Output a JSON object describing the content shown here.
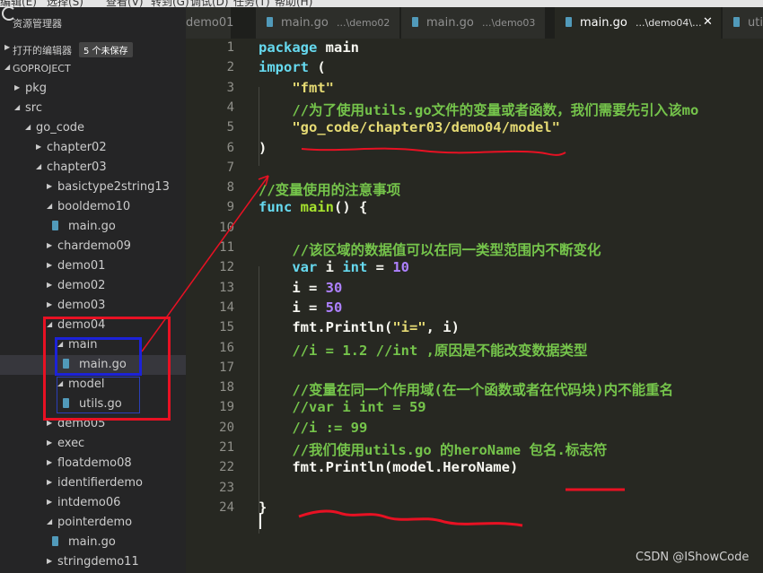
{
  "menubar": [
    "编辑(E)",
    "选择(S)",
    "查看(V)",
    "转到(G)",
    "调试(D)",
    "任务(T)",
    "帮助(H)"
  ],
  "explorer": {
    "title": "资源管理器",
    "open_editors_label": "打开的编辑器",
    "unsaved_badge": "5 个未保存",
    "project_label": "GOPROJECT",
    "tree": [
      {
        "name": "pkg",
        "kind": "folder",
        "depth": 0,
        "expanded": false
      },
      {
        "name": "src",
        "kind": "folder",
        "depth": 0,
        "expanded": true
      },
      {
        "name": "go_code",
        "kind": "folder",
        "depth": 1,
        "expanded": true
      },
      {
        "name": "chapter02",
        "kind": "folder",
        "depth": 2,
        "expanded": false
      },
      {
        "name": "chapter03",
        "kind": "folder",
        "depth": 2,
        "expanded": true
      },
      {
        "name": "basictype2string13",
        "kind": "folder",
        "depth": 3,
        "expanded": false
      },
      {
        "name": "booldemo10",
        "kind": "folder",
        "depth": 3,
        "expanded": true
      },
      {
        "name": "main.go",
        "kind": "file",
        "depth": 4
      },
      {
        "name": "chardemo09",
        "kind": "folder",
        "depth": 3,
        "expanded": false
      },
      {
        "name": "demo01",
        "kind": "folder",
        "depth": 3,
        "expanded": false
      },
      {
        "name": "demo02",
        "kind": "folder",
        "depth": 3,
        "expanded": false
      },
      {
        "name": "demo03",
        "kind": "folder",
        "depth": 3,
        "expanded": false
      },
      {
        "name": "demo04",
        "kind": "folder",
        "depth": 3,
        "expanded": true
      },
      {
        "name": "main",
        "kind": "folder",
        "depth": 4,
        "expanded": true
      },
      {
        "name": "main.go",
        "kind": "file",
        "depth": 5,
        "selected": true
      },
      {
        "name": "model",
        "kind": "folder",
        "depth": 4,
        "expanded": true
      },
      {
        "name": "utils.go",
        "kind": "file",
        "depth": 5
      },
      {
        "name": "demo05",
        "kind": "folder",
        "depth": 3,
        "expanded": false
      },
      {
        "name": "exec",
        "kind": "folder",
        "depth": 3,
        "expanded": false
      },
      {
        "name": "floatdemo08",
        "kind": "folder",
        "depth": 3,
        "expanded": false
      },
      {
        "name": "identifierdemo",
        "kind": "folder",
        "depth": 3,
        "expanded": false
      },
      {
        "name": "intdemo06",
        "kind": "folder",
        "depth": 3,
        "expanded": false
      },
      {
        "name": "pointerdemo",
        "kind": "folder",
        "depth": 3,
        "expanded": true
      },
      {
        "name": "main.go",
        "kind": "file",
        "depth": 4
      },
      {
        "name": "stringdemo11",
        "kind": "folder",
        "depth": 3,
        "expanded": false
      }
    ]
  },
  "tabs": [
    {
      "name": "demo01",
      "path": "",
      "active": false
    },
    {
      "name": "main.go",
      "path": "...\\demo02",
      "active": false
    },
    {
      "name": "main.go",
      "path": "...\\demo03",
      "active": false
    },
    {
      "name": "main.go",
      "path": "...\\demo04\\...",
      "active": true
    },
    {
      "name": "uti",
      "path": "",
      "active": false
    }
  ],
  "tab_close_glyph": "✕",
  "editor": {
    "lines": [
      [
        [
          "kw",
          "package"
        ],
        [
          "t",
          " main"
        ]
      ],
      [
        [
          "kw",
          "import"
        ],
        [
          "t",
          " ("
        ]
      ],
      [
        [
          "t",
          "    "
        ],
        [
          "str",
          "\"fmt\""
        ]
      ],
      [
        [
          "t",
          "    "
        ],
        [
          "cmt",
          "//为了使用utils.go文件的变量或者函数，我们需要先引入该mo"
        ]
      ],
      [
        [
          "t",
          "    "
        ],
        [
          "str",
          "\"go_code/chapter03/demo04/model\""
        ]
      ],
      [
        [
          "t",
          ")"
        ]
      ],
      [],
      [
        [
          "cmt",
          "//变量使用的注意事项"
        ]
      ],
      [
        [
          "kw",
          "func"
        ],
        [
          "t",
          " "
        ],
        [
          "fn",
          "main"
        ],
        [
          "t",
          "() {"
        ]
      ],
      [],
      [
        [
          "t",
          "    "
        ],
        [
          "cmt",
          "//该区域的数据值可以在同一类型范围内不断变化"
        ]
      ],
      [
        [
          "t",
          "    "
        ],
        [
          "kw",
          "var"
        ],
        [
          "t",
          " i "
        ],
        [
          "kw",
          "int"
        ],
        [
          "t",
          " = "
        ],
        [
          "num",
          "10"
        ]
      ],
      [
        [
          "t",
          "    i = "
        ],
        [
          "num",
          "30"
        ]
      ],
      [
        [
          "t",
          "    i = "
        ],
        [
          "num",
          "50"
        ]
      ],
      [
        [
          "t",
          "    fmt.Println("
        ],
        [
          "str",
          "\"i=\""
        ],
        [
          "t",
          ", i)"
        ]
      ],
      [
        [
          "t",
          "    "
        ],
        [
          "cmt",
          "//i = 1.2 //int ,原因是不能改变数据类型"
        ]
      ],
      [],
      [
        [
          "t",
          "    "
        ],
        [
          "cmt",
          "//变量在同一个作用域(在一个函数或者在代码块)内不能重名"
        ]
      ],
      [
        [
          "t",
          "    "
        ],
        [
          "cmt",
          "//var i int = 59"
        ]
      ],
      [
        [
          "t",
          "    "
        ],
        [
          "cmt",
          "//i := 99"
        ]
      ],
      [
        [
          "t",
          "    "
        ],
        [
          "cmt",
          "//我们使用utils.go 的heroName 包名.标志符"
        ]
      ],
      [
        [
          "t",
          "    fmt.Println(model.HeroName)"
        ]
      ],
      [],
      [
        [
          "t",
          "}"
        ]
      ]
    ]
  },
  "colors": {
    "editor_bg": "#272822",
    "keyword": "#66d9ef",
    "string": "#e6db74",
    "comment": "#75c44b",
    "number": "#ae81ff",
    "annotation_red": "#e81123",
    "annotation_blue": "#1c22d8",
    "go_file_icon": "#519aba"
  },
  "icons": {
    "file": "go-file-icon",
    "folder_open": "caret-down-icon",
    "folder_closed": "caret-right-icon",
    "app": "vscode-logo-icon"
  },
  "watermark": "CSDN @IShowCode"
}
